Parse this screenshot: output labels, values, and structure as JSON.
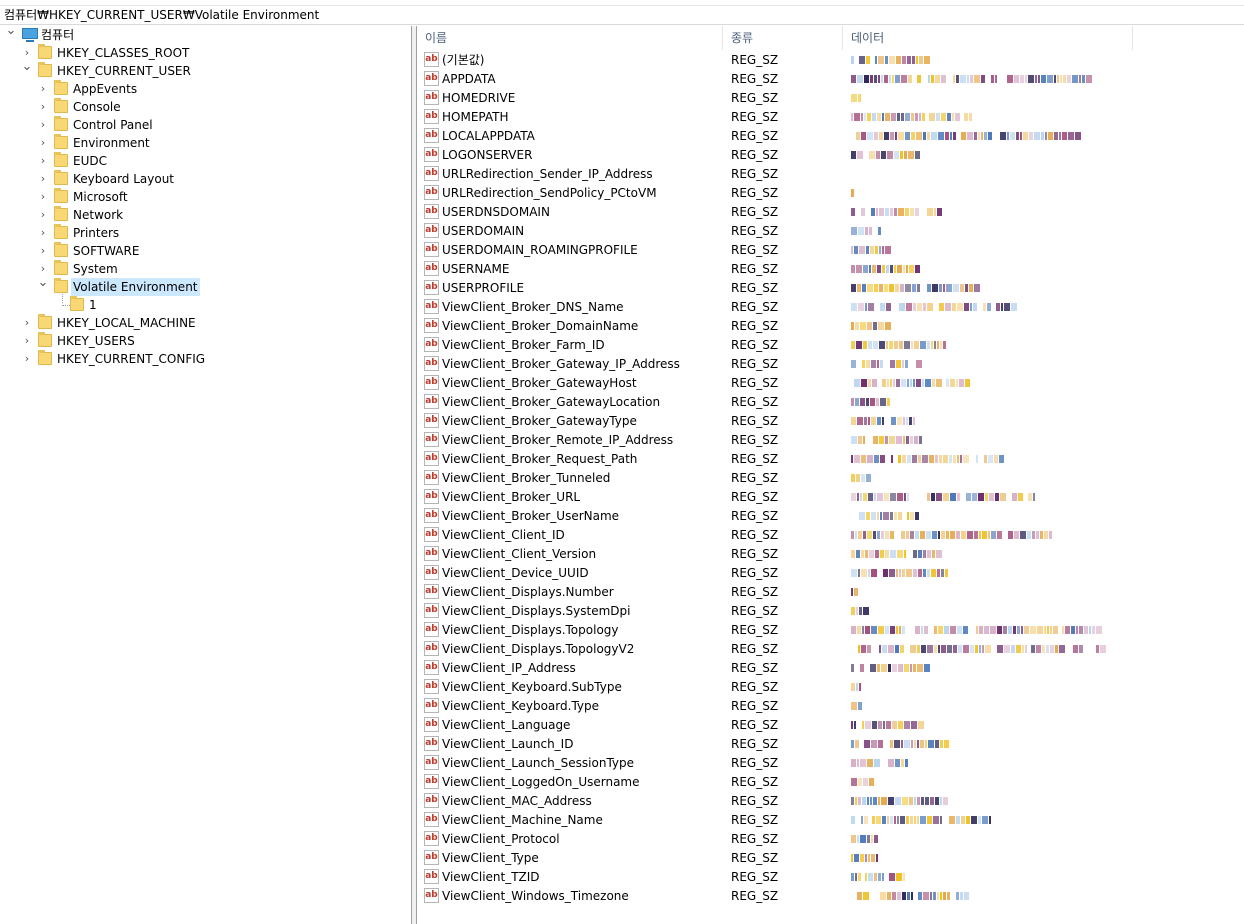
{
  "address": "컴퓨터₩HKEY_CURRENT_USER₩Volatile Environment",
  "tree": {
    "root": "컴퓨터",
    "hives": [
      "HKEY_CLASSES_ROOT",
      "HKEY_CURRENT_USER",
      "HKEY_LOCAL_MACHINE",
      "HKEY_USERS",
      "HKEY_CURRENT_CONFIG"
    ],
    "hkcu_children": [
      "AppEvents",
      "Console",
      "Control Panel",
      "Environment",
      "EUDC",
      "Keyboard Layout",
      "Microsoft",
      "Network",
      "Printers",
      "SOFTWARE",
      "System",
      "Volatile Environment"
    ],
    "volatile_child": "1"
  },
  "list": {
    "headers": {
      "name": "이름",
      "type": "종류",
      "data": "데이터"
    },
    "icon_text": "ab",
    "rows": [
      {
        "name": "(기본값)",
        "type": "REG_SZ"
      },
      {
        "name": "APPDATA",
        "type": "REG_SZ"
      },
      {
        "name": "HOMEDRIVE",
        "type": "REG_SZ"
      },
      {
        "name": "HOMEPATH",
        "type": "REG_SZ"
      },
      {
        "name": "LOCALAPPDATA",
        "type": "REG_SZ"
      },
      {
        "name": "LOGONSERVER",
        "type": "REG_SZ"
      },
      {
        "name": "URLRedirection_Sender_IP_Address",
        "type": "REG_SZ"
      },
      {
        "name": "URLRedirection_SendPolicy_PCtoVM",
        "type": "REG_SZ"
      },
      {
        "name": "USERDNSDOMAIN",
        "type": "REG_SZ"
      },
      {
        "name": "USERDOMAIN",
        "type": "REG_SZ"
      },
      {
        "name": "USERDOMAIN_ROAMINGPROFILE",
        "type": "REG_SZ"
      },
      {
        "name": "USERNAME",
        "type": "REG_SZ"
      },
      {
        "name": "USERPROFILE",
        "type": "REG_SZ"
      },
      {
        "name": "ViewClient_Broker_DNS_Name",
        "type": "REG_SZ"
      },
      {
        "name": "ViewClient_Broker_DomainName",
        "type": "REG_SZ"
      },
      {
        "name": "ViewClient_Broker_Farm_ID",
        "type": "REG_SZ"
      },
      {
        "name": "ViewClient_Broker_Gateway_IP_Address",
        "type": "REG_SZ"
      },
      {
        "name": "ViewClient_Broker_GatewayHost",
        "type": "REG_SZ"
      },
      {
        "name": "ViewClient_Broker_GatewayLocation",
        "type": "REG_SZ"
      },
      {
        "name": "ViewClient_Broker_GatewayType",
        "type": "REG_SZ"
      },
      {
        "name": "ViewClient_Broker_Remote_IP_Address",
        "type": "REG_SZ"
      },
      {
        "name": "ViewClient_Broker_Request_Path",
        "type": "REG_SZ"
      },
      {
        "name": "ViewClient_Broker_Tunneled",
        "type": "REG_SZ"
      },
      {
        "name": "ViewClient_Broker_URL",
        "type": "REG_SZ"
      },
      {
        "name": "ViewClient_Broker_UserName",
        "type": "REG_SZ"
      },
      {
        "name": "ViewClient_Client_ID",
        "type": "REG_SZ"
      },
      {
        "name": "ViewClient_Client_Version",
        "type": "REG_SZ"
      },
      {
        "name": "ViewClient_Device_UUID",
        "type": "REG_SZ"
      },
      {
        "name": "ViewClient_Displays.Number",
        "type": "REG_SZ"
      },
      {
        "name": "ViewClient_Displays.SystemDpi",
        "type": "REG_SZ"
      },
      {
        "name": "ViewClient_Displays.Topology",
        "type": "REG_SZ"
      },
      {
        "name": "ViewClient_Displays.TopologyV2",
        "type": "REG_SZ"
      },
      {
        "name": "ViewClient_IP_Address",
        "type": "REG_SZ"
      },
      {
        "name": "ViewClient_Keyboard.SubType",
        "type": "REG_SZ"
      },
      {
        "name": "ViewClient_Keyboard.Type",
        "type": "REG_SZ"
      },
      {
        "name": "ViewClient_Language",
        "type": "REG_SZ"
      },
      {
        "name": "ViewClient_Launch_ID",
        "type": "REG_SZ"
      },
      {
        "name": "ViewClient_Launch_SessionType",
        "type": "REG_SZ"
      },
      {
        "name": "ViewClient_LoggedOn_Username",
        "type": "REG_SZ"
      },
      {
        "name": "ViewClient_MAC_Address",
        "type": "REG_SZ"
      },
      {
        "name": "ViewClient_Machine_Name",
        "type": "REG_SZ"
      },
      {
        "name": "ViewClient_Protocol",
        "type": "REG_SZ"
      },
      {
        "name": "ViewClient_Type",
        "type": "REG_SZ"
      },
      {
        "name": "ViewClient_TZID",
        "type": "REG_SZ"
      },
      {
        "name": "ViewClient_Windows_Timezone",
        "type": "REG_SZ"
      }
    ]
  },
  "colors": {
    "selection": "#cce8ff",
    "folder": "#f8d775",
    "header_text": "#4c607a",
    "icon_text": "#c0392b",
    "pixelation_palette": [
      "#6b2d6b",
      "#e5a84a",
      "#b8d4ee",
      "#f3d089",
      "#2f2a5a",
      "#a34d7a",
      "#ffffff",
      "#d8b0c8",
      "#4a78b8",
      "#f0c020"
    ]
  }
}
